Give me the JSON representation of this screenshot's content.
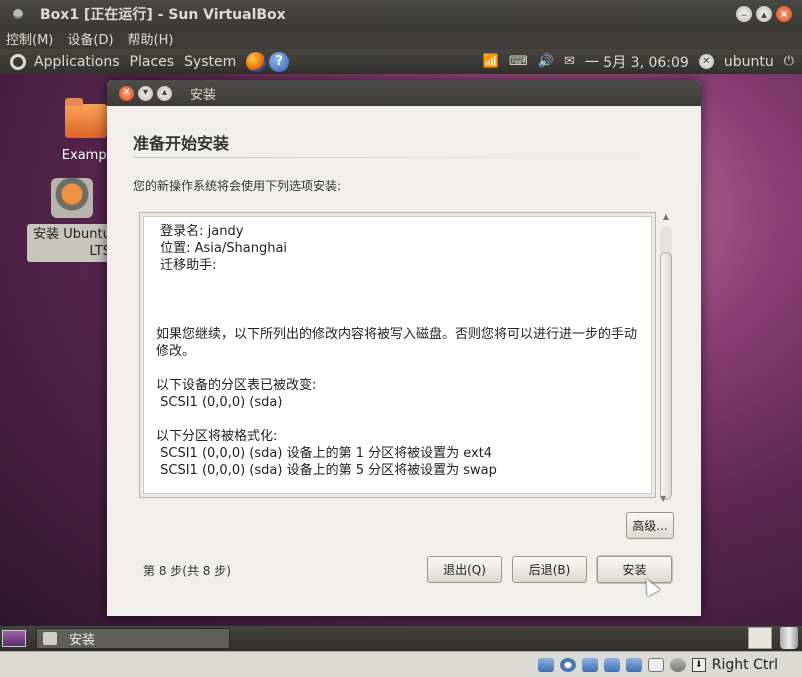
{
  "host_window": {
    "title": "Box1 [正在运行] - Sun VirtualBox",
    "menu": [
      "控制(M)",
      "设备(D)",
      "帮助(H)"
    ]
  },
  "top_panel": {
    "menus": [
      "Applications",
      "Places",
      "System"
    ],
    "clock": "一 5月  3, 06:09",
    "user": "ubuntu"
  },
  "desktop": {
    "icons": [
      {
        "label": "Exampl"
      },
      {
        "label_line1": "安装 Ubuntu",
        "label_line2": "LTS"
      }
    ]
  },
  "dialog": {
    "window_title": "安装",
    "heading": "准备开始安装",
    "subtitle": "您的新操作系统将会使用下列选项安装:",
    "summary_lines": [
      " 登录名: jandy",
      " 位置: Asia/Shanghai",
      " 迁移助手:",
      "",
      "",
      "",
      "如果您继续，以下所列出的修改内容将被写入磁盘。否则您将可以进行进一步的手动",
      "修改。",
      "",
      "以下设备的分区表已被改变:",
      " SCSI1 (0,0,0) (sda)",
      "",
      "以下分区将被格式化:",
      " SCSI1 (0,0,0) (sda) 设备上的第 1 分区将被设置为 ext4",
      " SCSI1 (0,0,0) (sda) 设备上的第 5 分区将被设置为 swap"
    ],
    "advanced_button": "高级...",
    "step_text": "第 8 步(共 8 步)",
    "quit_button": "退出(Q)",
    "back_button": "后退(B)",
    "install_button": "安装"
  },
  "bottom_panel": {
    "task_label": "安装"
  },
  "vb_status": {
    "host_key": "Right Ctrl"
  }
}
